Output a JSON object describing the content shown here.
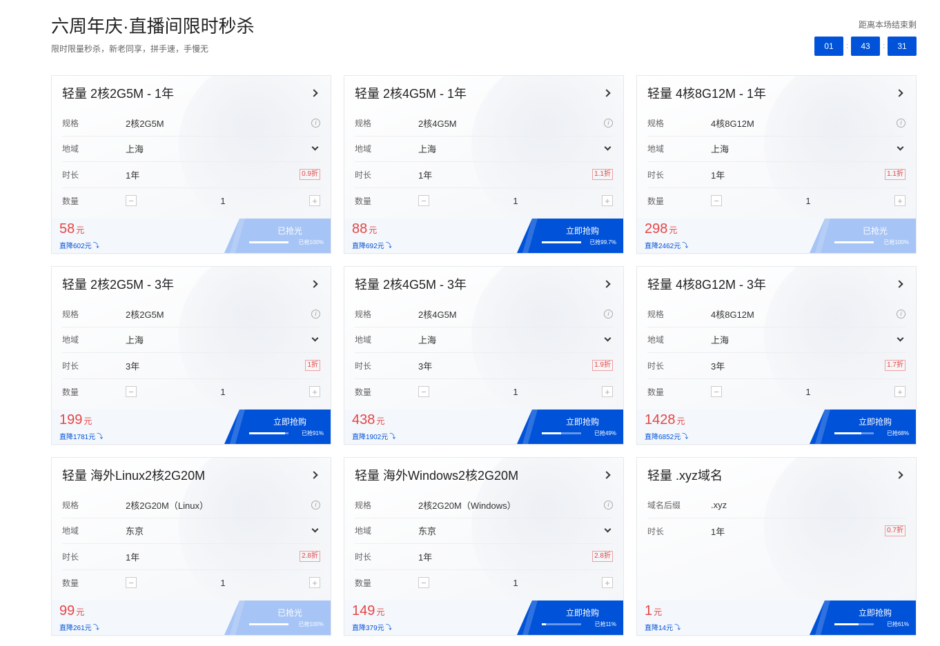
{
  "header": {
    "title": "六周年庆·直播间限时秒杀",
    "subtitle": "限时限量秒杀，新老同享，拼手速，手慢无"
  },
  "countdown": {
    "label": "距离本场结束剩",
    "hours": "01",
    "minutes": "43",
    "seconds": "31",
    "separator": ":"
  },
  "cards": [
    {
      "title": "轻量 2核2G5M - 1年",
      "rows": [
        {
          "label": "规格",
          "value": "2核2G5M",
          "control": "info"
        },
        {
          "label": "地域",
          "value": "上海",
          "control": "dropdown"
        },
        {
          "label": "时长",
          "value": "1年",
          "control": "discount",
          "badge": "0.9折"
        },
        {
          "label": "数量",
          "value": "1",
          "control": "stepper"
        }
      ],
      "price": "58",
      "unit": "元",
      "drop": "直降602元",
      "button": "已抢光",
      "sold_out": true,
      "progress_text": "已抢100%",
      "progress": 1.0
    },
    {
      "title": "轻量 2核4G5M - 1年",
      "rows": [
        {
          "label": "规格",
          "value": "2核4G5M",
          "control": "info"
        },
        {
          "label": "地域",
          "value": "上海",
          "control": "dropdown"
        },
        {
          "label": "时长",
          "value": "1年",
          "control": "discount",
          "badge": "1.1折"
        },
        {
          "label": "数量",
          "value": "1",
          "control": "stepper"
        }
      ],
      "price": "88",
      "unit": "元",
      "drop": "直降692元",
      "button": "立即抢购",
      "sold_out": false,
      "progress_text": "已抢99.7%",
      "progress": 0.997
    },
    {
      "title": "轻量 4核8G12M - 1年",
      "rows": [
        {
          "label": "规格",
          "value": "4核8G12M",
          "control": "info"
        },
        {
          "label": "地域",
          "value": "上海",
          "control": "dropdown"
        },
        {
          "label": "时长",
          "value": "1年",
          "control": "discount",
          "badge": "1.1折"
        },
        {
          "label": "数量",
          "value": "1",
          "control": "stepper"
        }
      ],
      "price": "298",
      "unit": "元",
      "drop": "直降2462元",
      "button": "已抢光",
      "sold_out": true,
      "progress_text": "已抢100%",
      "progress": 1.0
    },
    {
      "title": "轻量 2核2G5M - 3年",
      "rows": [
        {
          "label": "规格",
          "value": "2核2G5M",
          "control": "info"
        },
        {
          "label": "地域",
          "value": "上海",
          "control": "dropdown"
        },
        {
          "label": "时长",
          "value": "3年",
          "control": "discount",
          "badge": "1折"
        },
        {
          "label": "数量",
          "value": "1",
          "control": "stepper"
        }
      ],
      "price": "199",
      "unit": "元",
      "drop": "直降1781元",
      "button": "立即抢购",
      "sold_out": false,
      "progress_text": "已抢91%",
      "progress": 0.91
    },
    {
      "title": "轻量 2核4G5M - 3年",
      "rows": [
        {
          "label": "规格",
          "value": "2核4G5M",
          "control": "info"
        },
        {
          "label": "地域",
          "value": "上海",
          "control": "dropdown"
        },
        {
          "label": "时长",
          "value": "3年",
          "control": "discount",
          "badge": "1.9折"
        },
        {
          "label": "数量",
          "value": "1",
          "control": "stepper"
        }
      ],
      "price": "438",
      "unit": "元",
      "drop": "直降1902元",
      "button": "立即抢购",
      "sold_out": false,
      "progress_text": "已抢49%",
      "progress": 0.49
    },
    {
      "title": "轻量 4核8G12M - 3年",
      "rows": [
        {
          "label": "规格",
          "value": "4核8G12M",
          "control": "info"
        },
        {
          "label": "地域",
          "value": "上海",
          "control": "dropdown"
        },
        {
          "label": "时长",
          "value": "3年",
          "control": "discount",
          "badge": "1.7折"
        },
        {
          "label": "数量",
          "value": "1",
          "control": "stepper"
        }
      ],
      "price": "1428",
      "unit": "元",
      "drop": "直降6852元",
      "button": "立即抢购",
      "sold_out": false,
      "progress_text": "已抢68%",
      "progress": 0.68
    },
    {
      "title": "轻量 海外Linux2核2G20M",
      "rows": [
        {
          "label": "规格",
          "value": "2核2G20M（Linux）",
          "control": "info"
        },
        {
          "label": "地域",
          "value": "东京",
          "control": "dropdown"
        },
        {
          "label": "时长",
          "value": "1年",
          "control": "discount",
          "badge": "2.8折"
        },
        {
          "label": "数量",
          "value": "1",
          "control": "stepper"
        }
      ],
      "price": "99",
      "unit": "元",
      "drop": "直降261元",
      "button": "已抢光",
      "sold_out": true,
      "progress_text": "已抢100%",
      "progress": 1.0
    },
    {
      "title": "轻量 海外Windows2核2G20M",
      "rows": [
        {
          "label": "规格",
          "value": "2核2G20M（Windows）",
          "control": "info"
        },
        {
          "label": "地域",
          "value": "东京",
          "control": "dropdown"
        },
        {
          "label": "时长",
          "value": "1年",
          "control": "discount",
          "badge": "2.8折"
        },
        {
          "label": "数量",
          "value": "1",
          "control": "stepper"
        }
      ],
      "price": "149",
      "unit": "元",
      "drop": "直降379元",
      "button": "立即抢购",
      "sold_out": false,
      "progress_text": "已抢11%",
      "progress": 0.11
    },
    {
      "title": "轻量 .xyz域名",
      "rows": [
        {
          "label": "域名后缀",
          "value": ".xyz",
          "control": "none"
        },
        {
          "label": "时长",
          "value": "1年",
          "control": "discount",
          "badge": "0.7折"
        }
      ],
      "price": "1",
      "unit": "元",
      "drop": "直降14元",
      "button": "立即抢购",
      "sold_out": false,
      "progress_text": "已抢61%",
      "progress": 0.61
    }
  ],
  "icons": {
    "info": "info-icon",
    "dropdown": "chevron-down-icon",
    "card_link": "chevron-right-icon",
    "trend": "trend-down-icon",
    "minus": "minus-icon",
    "plus": "plus-icon"
  },
  "colors": {
    "primary": "#0052d9",
    "price": "#e54545",
    "soldout": "#a6c4f5"
  }
}
